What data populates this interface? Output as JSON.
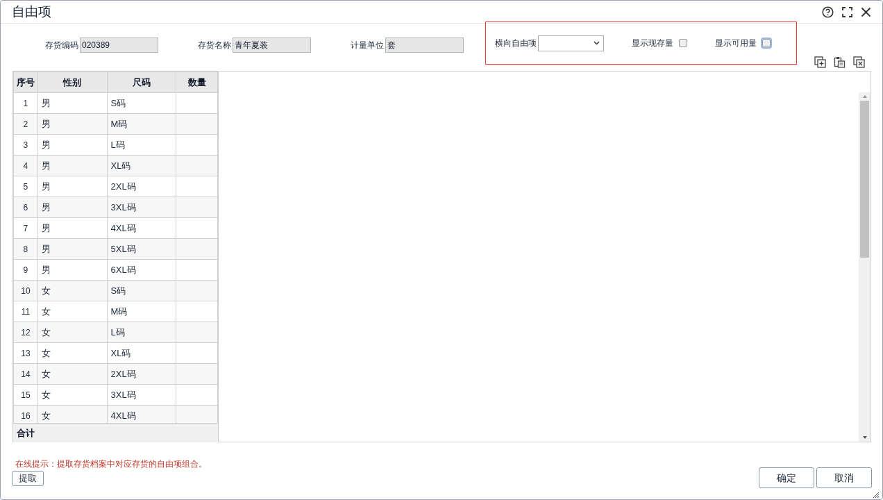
{
  "window": {
    "title": "自由项"
  },
  "fields": [
    {
      "label": "存货编码",
      "value": "020389"
    },
    {
      "label": "存货名称",
      "value": "青年夏装"
    },
    {
      "label": "计量单位",
      "value": "套"
    }
  ],
  "options": {
    "dropdown": {
      "label": "横向自由项"
    },
    "checkboxes": [
      {
        "label": "显示现存量",
        "checked": false,
        "focused": false
      },
      {
        "label": "显示可用量",
        "checked": false,
        "focused": true
      }
    ]
  },
  "table": {
    "columns": [
      "序号",
      "性别",
      "尺码",
      "数量"
    ],
    "rows": [
      {
        "no": "1",
        "gender": "男",
        "size": "S码"
      },
      {
        "no": "2",
        "gender": "男",
        "size": "M码"
      },
      {
        "no": "3",
        "gender": "男",
        "size": "L码"
      },
      {
        "no": "4",
        "gender": "男",
        "size": "XL码"
      },
      {
        "no": "5",
        "gender": "男",
        "size": "2XL码"
      },
      {
        "no": "6",
        "gender": "男",
        "size": "3XL码"
      },
      {
        "no": "7",
        "gender": "男",
        "size": "4XL码"
      },
      {
        "no": "8",
        "gender": "男",
        "size": "5XL码"
      },
      {
        "no": "9",
        "gender": "男",
        "size": "6XL码"
      },
      {
        "no": "10",
        "gender": "女",
        "size": "S码"
      },
      {
        "no": "11",
        "gender": "女",
        "size": "M码"
      },
      {
        "no": "12",
        "gender": "女",
        "size": "L码"
      },
      {
        "no": "13",
        "gender": "女",
        "size": "XL码"
      },
      {
        "no": "14",
        "gender": "女",
        "size": "2XL码"
      },
      {
        "no": "15",
        "gender": "女",
        "size": "3XL码"
      },
      {
        "no": "16",
        "gender": "女",
        "size": "4XL码"
      }
    ],
    "total_label": "合计"
  },
  "hint": "在线提示：提取存货档案中对应存货的自由项组合。",
  "fetch_button": "提取",
  "buttons": [
    "确定",
    "取消"
  ]
}
